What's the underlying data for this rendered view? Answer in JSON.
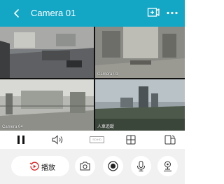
{
  "header": {
    "title": "Camera 01",
    "back_icon": "chevron-left-icon",
    "add_icon": "add-camera-icon",
    "more_icon": "more-dots-icon",
    "color": "#13a6c5"
  },
  "grid": {
    "cells": [
      {
        "label": "",
        "timestamp": ""
      },
      {
        "label": "Camera 01",
        "timestamp": ""
      },
      {
        "label": "Camera 04",
        "timestamp": ""
      },
      {
        "label": "人車追蹤",
        "timestamp": ""
      }
    ]
  },
  "controls": {
    "pause_icon": "pause-icon",
    "volume_icon": "volume-icon",
    "quality_label": "SD/HD",
    "layout_icon": "grid-layout-icon",
    "rotate_icon": "rotate-screen-icon"
  },
  "actions": {
    "playback_label": "播放",
    "snapshot_icon": "camera-icon",
    "record_icon": "record-icon",
    "mic_icon": "microphone-icon",
    "ptz_icon": "ptz-icon"
  }
}
